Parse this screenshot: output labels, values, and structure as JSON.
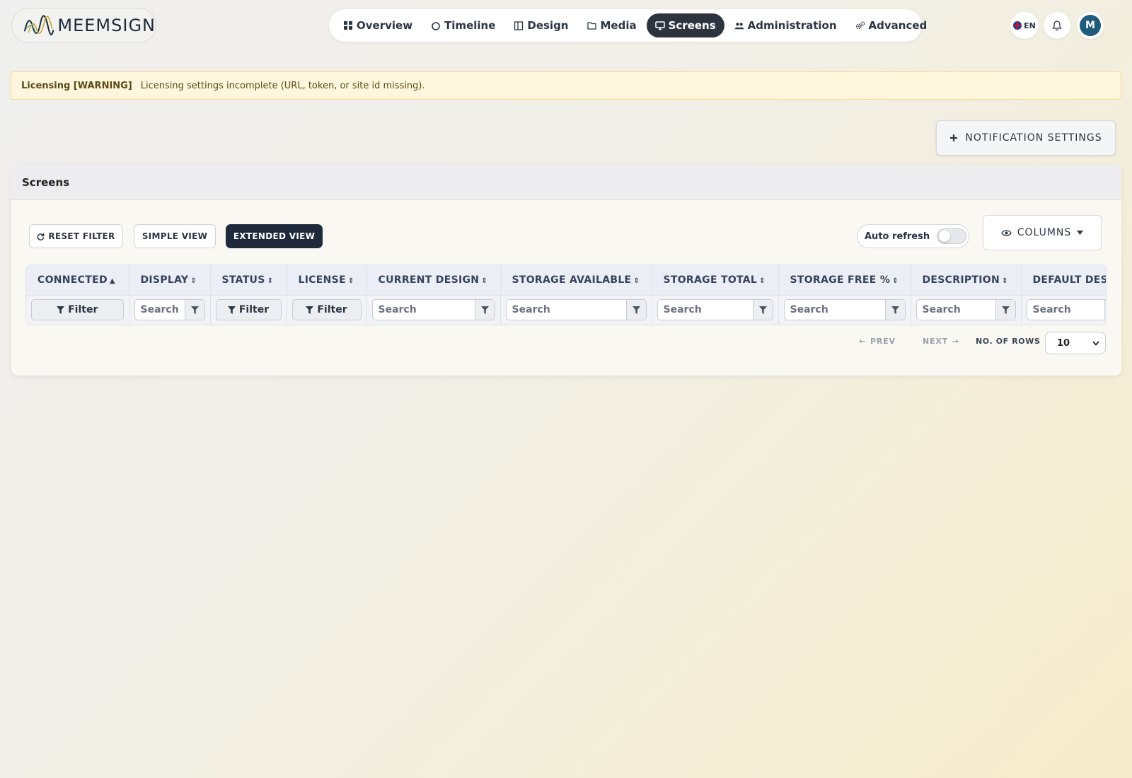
{
  "brand": {
    "name": "MEEMSIGN"
  },
  "nav": {
    "items": [
      {
        "label": "Overview",
        "icon": "grid-icon"
      },
      {
        "label": "Timeline",
        "icon": "circle-icon"
      },
      {
        "label": "Design",
        "icon": "layout-icon"
      },
      {
        "label": "Media",
        "icon": "folder-icon"
      },
      {
        "label": "Screens",
        "icon": "monitor-icon",
        "active": true
      },
      {
        "label": "Administration",
        "icon": "users-icon"
      },
      {
        "label": "Advanced",
        "icon": "gears-icon"
      }
    ]
  },
  "header_right": {
    "language": "EN",
    "avatar_initial": "M"
  },
  "warning": {
    "title": "Licensing [WARNING]",
    "message": "Licensing settings incomplete (URL, token, or site id missing)."
  },
  "notification_button": {
    "label": "NOTIFICATION SETTINGS"
  },
  "card": {
    "title": "Screens",
    "toolbar": {
      "reset_filter": "RESET FILTER",
      "simple_view": "SIMPLE VIEW",
      "extended_view": "EXTENDED VIEW",
      "auto_refresh": "Auto refresh",
      "auto_refresh_on": false,
      "columns": "COLUMNS"
    },
    "table": {
      "columns": [
        {
          "label": "CONNECTED",
          "sort": "asc",
          "filter": "button",
          "filter_label": "Filter"
        },
        {
          "label": "DISPLAY",
          "sort": "none",
          "filter": "search",
          "placeholder": "Search"
        },
        {
          "label": "STATUS",
          "sort": "none",
          "filter": "button",
          "filter_label": "Filter"
        },
        {
          "label": "LICENSE",
          "sort": "none",
          "filter": "button",
          "filter_label": "Filter"
        },
        {
          "label": "CURRENT DESIGN",
          "sort": "none",
          "filter": "search",
          "placeholder": "Search"
        },
        {
          "label": "STORAGE AVAILABLE",
          "sort": "none",
          "filter": "search",
          "placeholder": "Search"
        },
        {
          "label": "STORAGE TOTAL",
          "sort": "none",
          "filter": "search",
          "placeholder": "Search"
        },
        {
          "label": "STORAGE FREE %",
          "sort": "none",
          "filter": "search",
          "placeholder": "Search"
        },
        {
          "label": "DESCRIPTION",
          "sort": "none",
          "filter": "search",
          "placeholder": "Search"
        },
        {
          "label": "DEFAULT DESI",
          "sort": "none",
          "filter": "search",
          "placeholder": "Search"
        }
      ]
    },
    "pager": {
      "prev": "PREV",
      "next": "NEXT",
      "rows_label": "NO. OF ROWS",
      "rows_value": "10"
    }
  }
}
